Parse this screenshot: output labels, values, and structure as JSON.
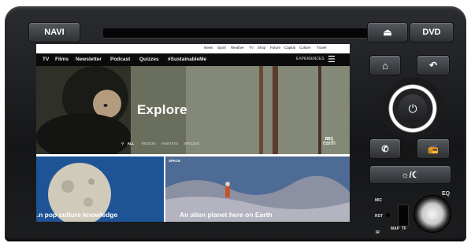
{
  "hardware": {
    "navi_label": "NAVI",
    "dvd_label": "DVD",
    "eject_icon": "eject-icon",
    "eq_label": "EQ",
    "mic_label": "MIC",
    "rst_label": "RST",
    "map_label": "MAP",
    "tf_label": "TF",
    "ir_label": "IR"
  },
  "site": {
    "top_links": [
      "News",
      "Sport",
      "Weather",
      "TV",
      "Shop",
      "Future",
      "Capital",
      "Culture",
      "Travel"
    ],
    "nav_items": [
      "TV",
      "Films",
      "Newsletter",
      "Podcast",
      "Quizzes",
      "#SustainableMe"
    ],
    "experiences_label": "EXPERIENCES",
    "hero": {
      "title": "Explore",
      "filters": [
        "ALL",
        "REGION",
        "HABITATS",
        "SPECIES"
      ],
      "brand_top": "BBC",
      "brand_bottom": "earth"
    },
    "cards": [
      {
        "title": "...n pop culture knowledge",
        "tag": ""
      },
      {
        "title": "An alien planet here on Earth",
        "tag": "SPACE"
      }
    ]
  }
}
